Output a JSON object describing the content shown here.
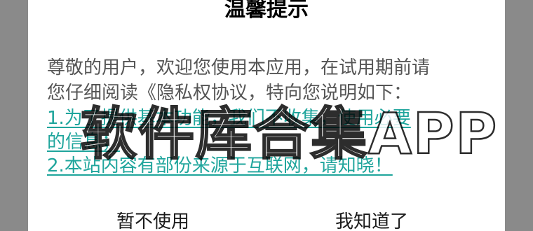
{
  "dialog": {
    "title": "温馨提示",
    "intro_line1": "尊敬的用户，欢迎您使用本应用，在试用期前请",
    "intro_line2": "您仔细阅读《隐私权协议，特向您说明如下：",
    "item1_line1": "1.为了提供基本功能，我们不收集，使用必要",
    "item1_line2": "的信息；",
    "item2": "2.本站内容有部份来源于互联网，请知晓！",
    "decline_button": "暂不使用",
    "accept_button": "我知道了"
  },
  "watermark": {
    "text": "软件库合集APP"
  },
  "colors": {
    "link": "#1fa59c",
    "body_text": "#555555",
    "overlay": "#8a8a8a"
  }
}
